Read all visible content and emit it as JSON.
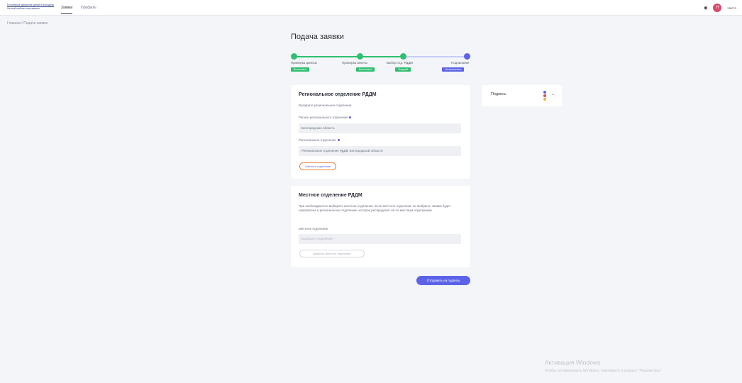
{
  "header": {
    "logo_line1": "Российское движение детей и молодёжи",
    "logo_line2": "Личный кабинет наставника",
    "nav": [
      {
        "label": "Заявки",
        "active": true
      },
      {
        "label": "Профиль",
        "active": false
      }
    ],
    "user_initial": "Н",
    "user_name": "Настя"
  },
  "breadcrumb": "Главная / Подача заявки",
  "page_title": "Подача заявки",
  "stepper": {
    "steps": [
      {
        "label": "Проверка данных",
        "badge": "Выполнено",
        "status": "done"
      },
      {
        "label": "Проверка анкеты",
        "badge": "Выполнено",
        "status": "done"
      },
      {
        "label": "Выбор отд. РДДМ",
        "badge": "Текущий",
        "status": "current"
      },
      {
        "label": "Подписание",
        "badge": "Не выполнено",
        "status": "pending"
      }
    ],
    "colors": {
      "done": "#2fbf71",
      "current": "#2fbf71",
      "pending": "#5c63e8"
    }
  },
  "regional": {
    "title": "Региональное отделение РДДМ",
    "hint": "Выберите региональное отделение",
    "region_label": "Регион регионального отделения",
    "region_value": "Белгородская область",
    "branch_label": "Региональное отделение",
    "branch_value": "Региональное отделение РДДМ Белгородской области",
    "change_button": "Сменить отделение"
  },
  "local": {
    "title": "Местное отделение РДДМ",
    "text": "При необходимости выберите местное отделение. Если местное отделение не выбрано, заявка будет направлена в региональное отделение, которое распределит её по местным отделениям.",
    "field_label": "Местное отделение",
    "field_placeholder": "Выберите отделение",
    "button": "Выбрать местное отделение"
  },
  "submit_button": "Отправить на подпись",
  "sign_card": {
    "label": "Подпись"
  },
  "windows": {
    "line1": "Активация Windows",
    "line2": "Чтобы активировать Windows, перейдите в раздел \"Параметры\"."
  },
  "colors": {
    "accent": "#5c63e8",
    "success": "#2fbf71",
    "change_button_border": "#e0873a"
  }
}
